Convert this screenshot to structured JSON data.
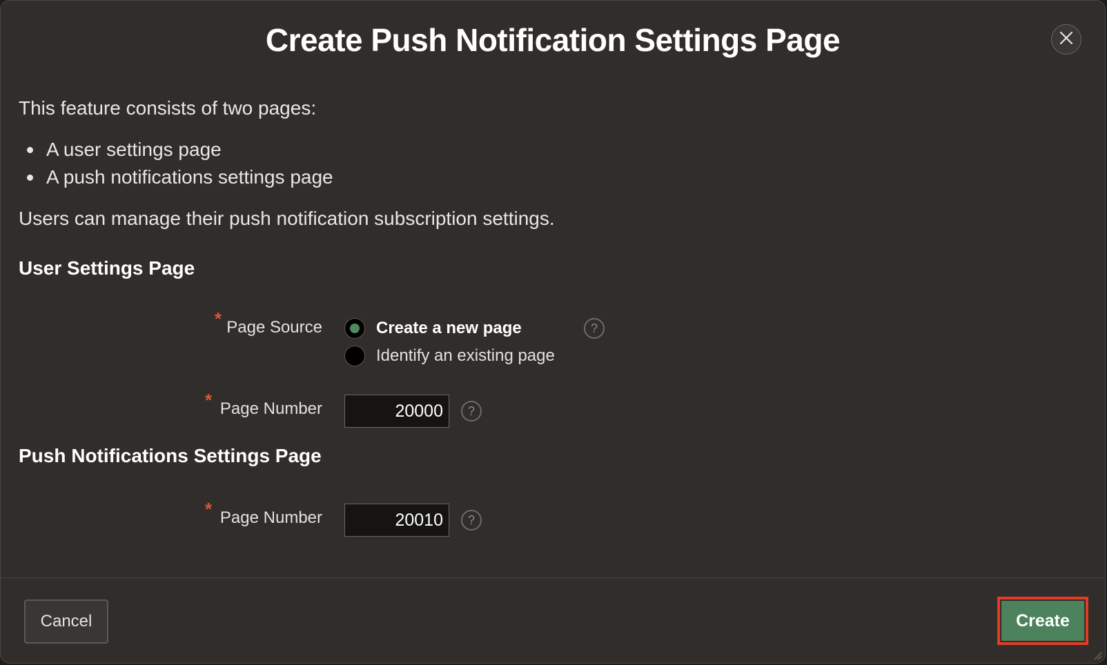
{
  "dialog": {
    "title": "Create Push Notification Settings Page",
    "close_icon": "close-icon"
  },
  "intro": {
    "text": "This feature consists of two pages:",
    "bullets": [
      "A user settings page",
      "A push notifications settings page"
    ],
    "note": "Users can manage their push notification subscription settings."
  },
  "user_settings": {
    "heading": "User Settings Page",
    "page_source": {
      "label": "Page Source",
      "required_mark": "*",
      "options": [
        {
          "label": "Create a new page",
          "selected": true
        },
        {
          "label": "Identify an existing page",
          "selected": false
        }
      ],
      "help_symbol": "?"
    },
    "page_number": {
      "label": "Page Number",
      "required_mark": "*",
      "value": "20000",
      "help_symbol": "?"
    }
  },
  "push_settings": {
    "heading": "Push Notifications Settings Page",
    "page_number": {
      "label": "Page Number",
      "required_mark": "*",
      "value": "20010",
      "help_symbol": "?"
    }
  },
  "footer": {
    "cancel_label": "Cancel",
    "create_label": "Create"
  },
  "colors": {
    "background": "#312d2a",
    "accent_green": "#4c825c",
    "required_red": "#d9553c",
    "highlight_border": "#e63a26"
  }
}
